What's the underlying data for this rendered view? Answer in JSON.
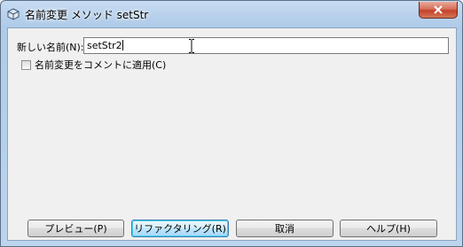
{
  "window": {
    "title": "名前変更 メソッド setStr"
  },
  "form": {
    "name_label": "新しい名前(N):",
    "name_value": "setStr2",
    "checkbox_label": "名前変更をコメントに適用(C)",
    "checkbox_checked": false
  },
  "buttons": {
    "preview": "プレビュー(P)",
    "refactor": "リファクタリング(R)",
    "cancel": "取消",
    "help": "ヘルプ(H)"
  },
  "icons": {
    "app": "netbeans-cube-icon",
    "close": "close-icon",
    "cursor": "text-cursor-icon"
  }
}
